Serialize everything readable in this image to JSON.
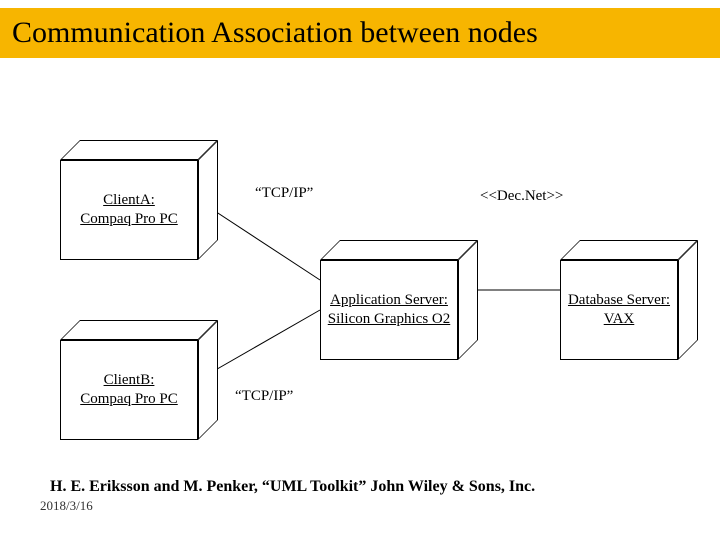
{
  "title": "Communication Association between nodes",
  "nodes": {
    "clientA": "ClientA:\nCompaq Pro PC",
    "clientB": "ClientB:\nCompaq Pro PC",
    "appServer": "Application Server:\nSilicon Graphics O2",
    "dbServer": "Database Server:\nVAX"
  },
  "labels": {
    "tcpipTop": "“TCP/IP”",
    "tcpipBottom": "“TCP/IP”",
    "decnet": "<<Dec.Net>>"
  },
  "footer": {
    "citation": "H. E. Eriksson and M. Penker, “UML Toolkit” John Wiley & Sons, Inc.",
    "date": "2018/3/16"
  }
}
